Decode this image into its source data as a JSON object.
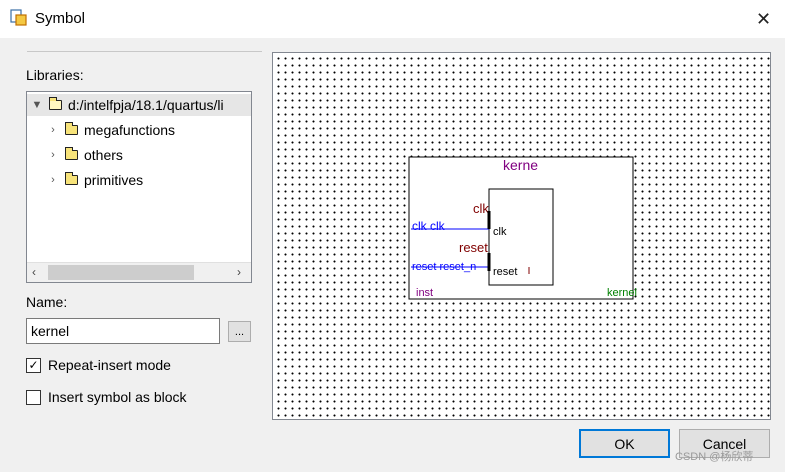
{
  "window": {
    "title": "Symbol",
    "close_glyph": "✕",
    "icon": "symbol-app-icon"
  },
  "libraries": {
    "label": "Libraries:",
    "root": "d:/intelfpja/18.1/quartus/li",
    "items": [
      {
        "label": "megafunctions"
      },
      {
        "label": "others"
      },
      {
        "label": "primitives"
      }
    ]
  },
  "name": {
    "label": "Name:",
    "value": "kernel",
    "browse_label": "..."
  },
  "options": {
    "repeat_insert": {
      "label": "Repeat-insert mode",
      "checked": true
    },
    "insert_block": {
      "label": "Insert symbol as block",
      "checked": false
    }
  },
  "preview": {
    "outer_title": "kerne",
    "inner_clk_label": "clk",
    "inner_reset_label": "reset",
    "port_clk": "clk",
    "port_reset": "reset",
    "wire_clk": "clk  clk",
    "wire_reset": "reset  reset_n",
    "reset_small": "reset",
    "inst_label": "inst",
    "kernel_label": "kernel"
  },
  "buttons": {
    "ok": "OK",
    "cancel": "Cancel"
  },
  "watermark": "CSDN @杨欣蒂",
  "colors": {
    "accent": "#0078d7",
    "wire": "#0000ff",
    "title_purple": "#800080",
    "label_dark_red": "#800000",
    "kernel_green": "#008000"
  }
}
